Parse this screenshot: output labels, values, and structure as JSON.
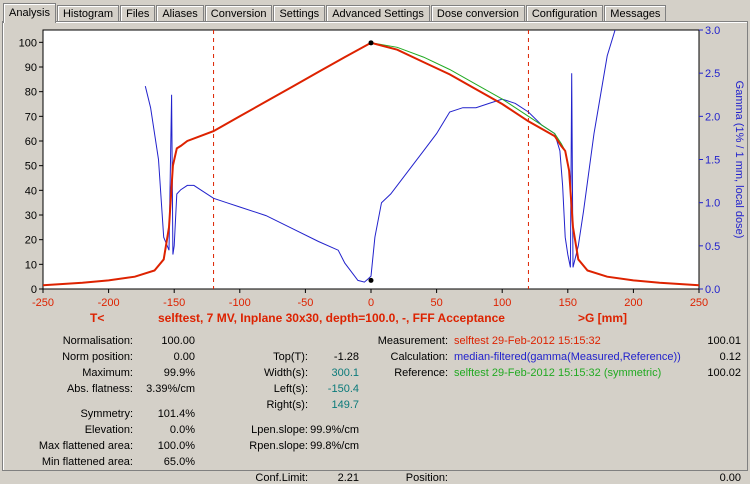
{
  "tabs": [
    "Analysis",
    "Histogram",
    "Files",
    "Aliases",
    "Conversion",
    "Settings",
    "Advanced Settings",
    "Dose conversion",
    "Configuration",
    "Messages"
  ],
  "colors": {
    "measured": "#dd2200",
    "reference": "#22aa22",
    "gamma": "#2222cc",
    "left_axis": "#000000",
    "right_axis": "#2222cc",
    "x_axis": "#dd2200"
  },
  "chart_data": {
    "type": "line",
    "title": "selftest, 7 MV, Inplane 30x30, depth=100.0, -, FFF Acceptance",
    "left_marker": "T<",
    "right_marker": ">G  [mm]",
    "xlim": [
      -250,
      250
    ],
    "ylim": [
      0,
      105
    ],
    "y2lim": [
      0,
      3.0
    ],
    "y2label": "Gamma (1% / 1 mm, local dose)",
    "xticks": [
      -250,
      -200,
      -150,
      -100,
      -50,
      0,
      50,
      100,
      150,
      200,
      250
    ],
    "yticks": [
      0,
      10,
      20,
      30,
      40,
      50,
      60,
      70,
      80,
      90,
      100
    ],
    "y2ticks": [
      "0.0",
      "0.5",
      "1.0",
      "1.5",
      "2.0",
      "2.5",
      "3.0"
    ],
    "markers_x": [
      -120,
      120
    ],
    "series": [
      {
        "key": "measured",
        "x": [
          -250,
          -220,
          -200,
          -180,
          -165,
          -158,
          -154,
          -151,
          -148,
          -145,
          -140,
          -130,
          -120,
          -100,
          -80,
          -60,
          -40,
          -20,
          0,
          20,
          40,
          60,
          80,
          100,
          120,
          140,
          145,
          148,
          151,
          154,
          158,
          165,
          180,
          200,
          220,
          250
        ],
        "y": [
          1.5,
          2.5,
          3.5,
          5,
          7.5,
          12,
          25,
          50,
          57,
          58,
          60,
          62,
          64,
          70,
          76,
          82,
          88,
          94,
          99.8,
          97,
          92,
          87,
          81,
          75,
          68,
          62,
          58,
          56,
          48,
          25,
          12,
          7.5,
          5,
          3.5,
          2.5,
          1.5
        ]
      },
      {
        "key": "reference",
        "x": [
          -250,
          -220,
          -200,
          -180,
          -165,
          -158,
          -154,
          -151,
          -148,
          -145,
          -140,
          -130,
          -120,
          -100,
          -80,
          -60,
          -40,
          -20,
          0,
          20,
          40,
          60,
          80,
          100,
          120,
          140,
          145,
          148,
          151,
          154,
          158,
          165,
          180,
          200,
          220,
          250
        ],
        "y": [
          1.5,
          2.5,
          3.5,
          5,
          7.5,
          12,
          25,
          50,
          57,
          58,
          60,
          62,
          64,
          70,
          76,
          82,
          88,
          94,
          99.8,
          98,
          94,
          89,
          83,
          77,
          70,
          63,
          59,
          56,
          48,
          25,
          12,
          7.5,
          5,
          3.5,
          2.5,
          1.5
        ]
      },
      {
        "key": "gamma",
        "axis": "right",
        "x": [
          -172,
          -168,
          -162,
          -158,
          -154,
          -152,
          -151,
          -150,
          -148,
          -145,
          -140,
          -135,
          -130,
          -120,
          -110,
          -100,
          -80,
          -60,
          -40,
          -25,
          -20,
          -15,
          -10,
          -5,
          -2,
          0,
          3,
          8,
          15,
          25,
          40,
          50,
          60,
          70,
          80,
          90,
          100,
          110,
          120,
          130,
          140,
          144,
          146,
          148,
          150,
          152,
          153,
          154,
          158,
          162,
          170,
          180,
          188
        ],
        "y": [
          2.35,
          2.1,
          1.5,
          0.6,
          0.45,
          2.25,
          0.4,
          0.5,
          1.1,
          1.15,
          1.2,
          1.2,
          1.15,
          1.05,
          1.0,
          0.95,
          0.85,
          0.7,
          0.55,
          0.45,
          0.3,
          0.2,
          0.1,
          0.08,
          0.12,
          0.15,
          0.6,
          1.0,
          1.1,
          1.3,
          1.6,
          1.8,
          2.05,
          2.1,
          2.1,
          2.15,
          2.2,
          2.15,
          2.05,
          1.9,
          1.8,
          1.6,
          1.2,
          0.6,
          0.4,
          0.25,
          2.5,
          0.25,
          0.5,
          0.9,
          1.8,
          2.7,
          3.1
        ]
      }
    ],
    "max_point": {
      "x": 0,
      "y": 99.8
    },
    "min_gamma_point": {
      "x": 0,
      "y": 0.1
    }
  },
  "stats": {
    "col1": [
      {
        "label": "Normalisation:",
        "value": "100.00"
      },
      {
        "label": "Norm position:",
        "value": "0.00"
      },
      {
        "label": "Maximum:",
        "value": "99.9%"
      },
      {
        "label": "Abs. flatness:",
        "value": "3.39%/cm"
      },
      {
        "label": "Symmetry:",
        "value": "101.4%"
      },
      {
        "label": "Elevation:",
        "value": "0.0%"
      },
      {
        "label": "Max flattened area:",
        "value": "100.0%"
      },
      {
        "label": "Min flattened area:",
        "value": "65.0%"
      }
    ],
    "col2": [
      {
        "label": "Top(T):",
        "value": "-1.28",
        "color": "#000000"
      },
      {
        "label": "Width(s):",
        "value": "300.1",
        "color": "#0a7a7a"
      },
      {
        "label": "Left(s):",
        "value": "-150.4",
        "color": "#0a7a7a"
      },
      {
        "label": "Right(s):",
        "value": "149.7",
        "color": "#0a7a7a"
      },
      {
        "label": "Lpen.slope:",
        "value": "99.9%/cm",
        "color": "#000000"
      },
      {
        "label": "Rpen.slope:",
        "value": "99.8%/cm",
        "color": "#000000"
      },
      {
        "label": "Conf.Limit:",
        "value": "2.21",
        "color": "#000000"
      }
    ],
    "col3": [
      {
        "label": "Measurement:",
        "text": "selftest 29-Feb-2012 15:15:32",
        "color": "#dd2200",
        "value": "100.01"
      },
      {
        "label": "Calculation:",
        "text": "median-filtered(gamma(Measured,Reference))",
        "color": "#2222cc",
        "value": "0.12"
      },
      {
        "label": "Reference:",
        "text": "selftest 29-Feb-2012 15:15:32 (symmetric)",
        "color": "#22aa22",
        "value": "100.02"
      },
      {
        "label": "Position:",
        "text": "",
        "color": "#000000",
        "value": "0.00"
      }
    ]
  }
}
